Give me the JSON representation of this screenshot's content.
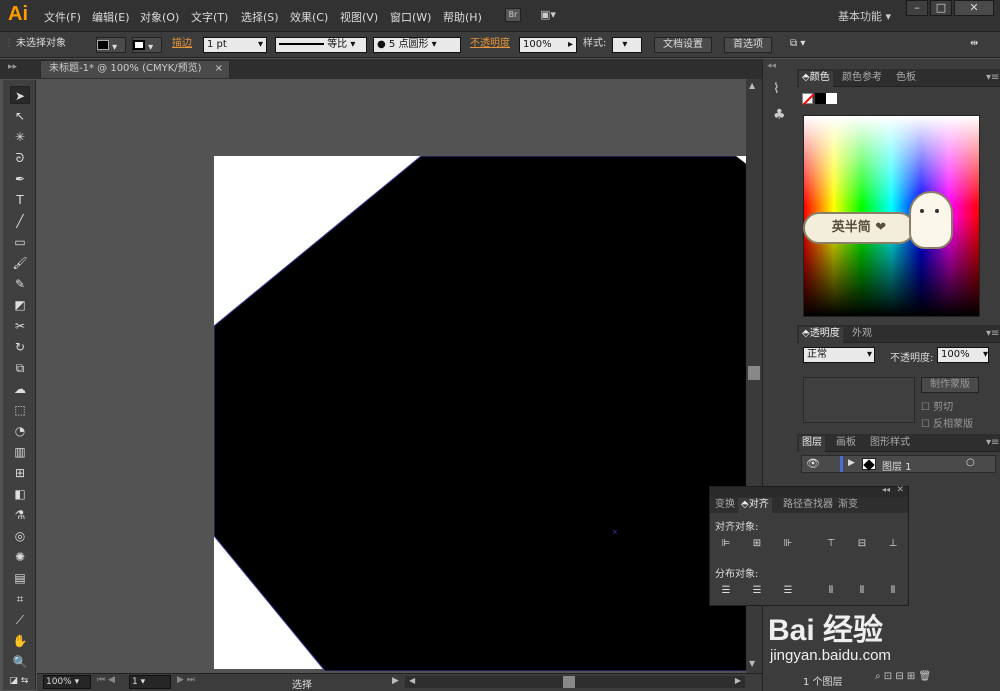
{
  "app": {
    "logo": "Ai",
    "workspace": "基本功能"
  },
  "menu": [
    "文件(F)",
    "编辑(E)",
    "对象(O)",
    "文字(T)",
    "选择(S)",
    "效果(C)",
    "视图(V)",
    "窗口(W)",
    "帮助(H)"
  ],
  "bridge_label": "Br",
  "control": {
    "selection": "未选择对象",
    "stroke_label": "描边",
    "stroke_weight": "1 pt",
    "profile": "等比",
    "brush": "5 点圆形",
    "opacity_label": "不透明度",
    "opacity_value": "100%",
    "style_label": "样式:",
    "doc_setup": "文档设置",
    "preferences": "首选项"
  },
  "document_tab": {
    "title": "未标题-1* @ 100% (CMYK/预览)",
    "close": "×"
  },
  "status": {
    "zoom": "100%",
    "artboard": "1",
    "tool": "选择"
  },
  "panels": {
    "color_tabs": [
      "颜色",
      "颜色参考",
      "色板"
    ],
    "transparency_tabs": [
      "透明度",
      "外观"
    ],
    "blend_mode": "正常",
    "opacity_label": "不透明度:",
    "opacity_value": "100%",
    "make_mask": "制作蒙版",
    "clip": "剪切",
    "invert_mask": "反相蒙版",
    "layers_tabs": [
      "图层",
      "画板",
      "图形样式"
    ],
    "layer_name": "图层 1",
    "layer_count": "1 个图层",
    "sticker_text": "英半简 ❤"
  },
  "align_panel": {
    "tabs": [
      "变换",
      "对齐",
      "路径查找器",
      "渐变"
    ],
    "align_objects": "对齐对象:",
    "distribute_objects": "分布对象:"
  },
  "watermark": {
    "brand": "Bai 经验",
    "url": "jingyan.baidu.com"
  },
  "colors": {
    "accent": "#ff9a00",
    "panel": "#3c3c3c",
    "canvas": "#535353"
  }
}
